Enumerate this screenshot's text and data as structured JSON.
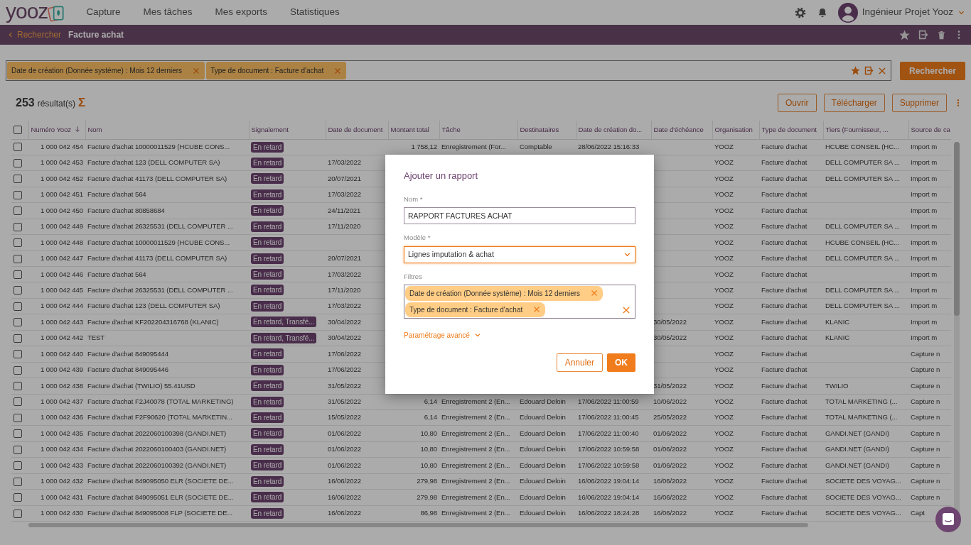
{
  "top_nav": {
    "logo": "yooz",
    "items": [
      {
        "label": "Capture",
        "selected": false
      },
      {
        "label": "Mes tâches",
        "selected": false
      },
      {
        "label": "Mes exports",
        "selected": false
      },
      {
        "label": "Statistiques",
        "selected": false
      }
    ],
    "user": "Ingénieur Projet Yooz"
  },
  "breadcrumb": {
    "back": "Rechercher",
    "title": "Facture achat"
  },
  "search": {
    "chips": [
      "Date de création (Donnée système) : Mois 12 derniers",
      "Type de document : Facture d'achat"
    ],
    "button": "Rechercher"
  },
  "results": {
    "count": "253",
    "label": "résultat(s)",
    "sum_symbol": "Σ",
    "actions": [
      "Ouvrir",
      "Télécharger",
      "Supprimer"
    ]
  },
  "table": {
    "select_all_checked": false,
    "columns": [
      {
        "label": "Numéro Yooz",
        "sorted_descending": true
      },
      {
        "label": "Nom"
      },
      {
        "label": "Signalement"
      },
      {
        "label": "Date de document"
      },
      {
        "label": "Montant total"
      },
      {
        "label": "Tâche"
      },
      {
        "label": "Destinataires"
      },
      {
        "label": "Date de création do..."
      },
      {
        "label": "Date d'échéance"
      },
      {
        "label": "Organisation"
      },
      {
        "label": "Type de document"
      },
      {
        "label": "Tiers (Fournisseur, ..."
      },
      {
        "label": "Source de ca"
      }
    ],
    "rows": [
      {
        "checked": false,
        "number": "1 000 042 454",
        "name": "Facture d'achat 10000011529 (HCUBE CONS...",
        "flag": "En retard",
        "amount": "1 758,12",
        "task": "Enregistrement (For...",
        "recipients": "Comptable",
        "created": "28/06/2022 15:16:33",
        "org": "YOOZ",
        "doc_type": "Facture d'achat",
        "third_party": "HCUBE CONSEIL (HC...",
        "source": "Import m"
      },
      {
        "checked": false,
        "number": "1 000 042 453",
        "name": "Facture d'achat 123 (DELL COMPUTER SA)",
        "flag": "En retard",
        "doc_date": "17/03/2022",
        "org": "YOOZ",
        "doc_type": "Facture d'achat",
        "third_party": "DELL COMPUTER SA ...",
        "source": "Import m"
      },
      {
        "checked": false,
        "number": "1 000 042 452",
        "name": "Facture d'achat 41173 (DELL COMPUTER SA)",
        "flag": "En retard",
        "doc_date": "20/07/2021",
        "org": "YOOZ",
        "doc_type": "Facture d'achat",
        "third_party": "DELL COMPUTER SA ...",
        "source": "Import m"
      },
      {
        "checked": false,
        "number": "1 000 042 451",
        "name": "Facture d'achat 564",
        "flag": "En retard",
        "doc_date": "17/03/2022",
        "org": "YOOZ",
        "doc_type": "Facture d'achat",
        "source": "Import m"
      },
      {
        "checked": false,
        "number": "1 000 042 450",
        "name": "Facture d'achat 80858684",
        "flag": "En retard",
        "doc_date": "24/11/2021",
        "org": "YOOZ",
        "doc_type": "Facture d'achat",
        "source": "Import m"
      },
      {
        "checked": false,
        "number": "1 000 042 449",
        "name": "Facture d'achat 26325531 (DELL COMPUTER ...",
        "flag": "En retard",
        "doc_date": "17/11/2020",
        "org": "YOOZ",
        "doc_type": "Facture d'achat",
        "third_party": "DELL COMPUTER SA ...",
        "source": "Import m"
      },
      {
        "checked": false,
        "number": "1 000 042 448",
        "name": "Facture d'achat 10000011529 (HCUBE CONS...",
        "flag": "En retard",
        "org": "YOOZ",
        "doc_type": "Facture d'achat",
        "third_party": "HCUBE CONSEIL (HC...",
        "source": "Import m"
      },
      {
        "checked": false,
        "number": "1 000 042 447",
        "name": "Facture d'achat 41173 (DELL COMPUTER SA)",
        "flag": "En retard",
        "doc_date": "20/07/2021",
        "org": "YOOZ",
        "doc_type": "Facture d'achat",
        "third_party": "DELL COMPUTER SA ...",
        "source": "Import m"
      },
      {
        "checked": false,
        "number": "1 000 042 446",
        "name": "Facture d'achat 564",
        "flag": "En retard",
        "doc_date": "17/03/2022",
        "org": "YOOZ",
        "doc_type": "Facture d'achat",
        "source": "Import m"
      },
      {
        "checked": false,
        "number": "1 000 042 445",
        "name": "Facture d'achat 26325531 (DELL COMPUTER ...",
        "flag": "En retard",
        "doc_date": "17/11/2020",
        "org": "YOOZ",
        "doc_type": "Facture d'achat",
        "third_party": "DELL COMPUTER SA ...",
        "source": "Import m"
      },
      {
        "checked": false,
        "number": "1 000 042 444",
        "name": "Facture d'achat 123 (DELL COMPUTER SA)",
        "flag": "En retard",
        "doc_date": "17/03/2022",
        "org": "YOOZ",
        "doc_type": "Facture d'achat",
        "third_party": "DELL COMPUTER SA ...",
        "source": "Import m"
      },
      {
        "checked": false,
        "number": "1 000 042 443",
        "name": "Facture d'achat KF202204316768 (KLANIC)",
        "flag": "En retard, Transfé...",
        "doc_date": "30/04/2022",
        "due": "30/05/2022",
        "org": "YOOZ",
        "doc_type": "Facture d'achat",
        "third_party": "KLANIC",
        "source": "Import m"
      },
      {
        "checked": false,
        "number": "1 000 042 442",
        "name": "TEST",
        "flag": "En retard, Transfé...",
        "doc_date": "30/04/2022",
        "due": "30/05/2022",
        "org": "YOOZ",
        "doc_type": "Facture d'achat",
        "third_party": "KLANIC",
        "source": "Import m"
      },
      {
        "checked": false,
        "number": "1 000 042 440",
        "name": "Facture d'achat 849095444",
        "flag": "En retard",
        "doc_date": "17/06/2022",
        "org": "YOOZ",
        "doc_type": "Facture d'achat",
        "source": "Capture n"
      },
      {
        "checked": false,
        "number": "1 000 042 439",
        "name": "Facture d'achat 849095446",
        "flag": "En retard",
        "doc_date": "17/06/2022",
        "org": "YOOZ",
        "doc_type": "Facture d'achat",
        "source": "Capture n"
      },
      {
        "checked": false,
        "number": "1 000 042 438",
        "name": "Facture d'achat (TWILIO) 55.41USD",
        "flag": "En retard",
        "doc_date": "31/05/2022",
        "due": "31/05/2022",
        "org": "YOOZ",
        "doc_type": "Facture d'achat",
        "third_party": "TWILIO",
        "source": "Capture n"
      },
      {
        "checked": false,
        "number": "1 000 042 437",
        "name": "Facture d'achat F2J40078 (TOTAL MARKETING)",
        "flag": "En retard",
        "doc_date": "31/05/2022",
        "amount": "6,14",
        "task": "Enregistrement 2 (En...",
        "recipients": "Edouard Deloin",
        "created": "17/06/2022 11:00:59",
        "due": "10/06/2022",
        "org": "YOOZ",
        "doc_type": "Facture d'achat",
        "third_party": "TOTAL MARKETING (...",
        "source": "Capture n"
      },
      {
        "checked": false,
        "number": "1 000 042 436",
        "name": "Facture d'achat F2F90620 (TOTAL MARKETIN...",
        "flag": "En retard",
        "doc_date": "15/05/2022",
        "amount": "6,14",
        "task": "Enregistrement 2 (En...",
        "recipients": "Edouard Deloin",
        "created": "17/06/2022 11:00:45",
        "due": "25/05/2022",
        "org": "YOOZ",
        "doc_type": "Facture d'achat",
        "third_party": "TOTAL MARKETING (...",
        "source": "Capture n"
      },
      {
        "checked": false,
        "number": "1 000 042 435",
        "name": "Facture d'achat 2022060100398 (GANDI.NET)",
        "flag": "En retard",
        "doc_date": "01/06/2022",
        "amount": "10,80",
        "task": "Enregistrement 2 (En...",
        "recipients": "Edouard Deloin",
        "created": "17/06/2022 11:00:40",
        "due": "01/06/2022",
        "org": "YOOZ",
        "doc_type": "Facture d'achat",
        "third_party": "GANDI.NET (GANDI)",
        "source": "Capture n"
      },
      {
        "checked": false,
        "number": "1 000 042 434",
        "name": "Facture d'achat 2022060100403 (GANDI.NET)",
        "flag": "En retard",
        "doc_date": "01/06/2022",
        "amount": "10,80",
        "task": "Enregistrement 2 (En...",
        "recipients": "Edouard Deloin",
        "created": "17/06/2022 10:59:58",
        "due": "01/06/2022",
        "org": "YOOZ",
        "doc_type": "Facture d'achat",
        "third_party": "GANDI.NET (GANDI)",
        "source": "Capture n"
      },
      {
        "checked": false,
        "number": "1 000 042 433",
        "name": "Facture d'achat 2022060100392 (GANDI.NET)",
        "flag": "En retard",
        "doc_date": "01/06/2022",
        "amount": "10,80",
        "task": "Enregistrement 2 (En...",
        "recipients": "Edouard Deloin",
        "created": "17/06/2022 10:59:58",
        "due": "01/06/2022",
        "org": "YOOZ",
        "doc_type": "Facture d'achat",
        "third_party": "GANDI.NET (GANDI)",
        "source": "Capture n"
      },
      {
        "checked": false,
        "number": "1 000 042 432",
        "name": "Facture d'achat 849095050 ELR (SOCIETE DE...",
        "flag": "En retard",
        "doc_date": "16/06/2022",
        "amount": "279,98",
        "task": "Enregistrement 2 (En...",
        "recipients": "Edouard Deloin",
        "created": "16/06/2022 19:04:14",
        "due": "16/06/2022",
        "org": "YOOZ",
        "doc_type": "Facture d'achat",
        "third_party": "SOCIETE DES VOYAG...",
        "source": "Capture n"
      },
      {
        "checked": false,
        "number": "1 000 042 431",
        "name": "Facture d'achat 849095051 ELR (SOCIETE DE...",
        "flag": "En retard",
        "doc_date": "16/06/2022",
        "amount": "279,98",
        "task": "Enregistrement 2 (En...",
        "recipients": "Edouard Deloin",
        "created": "16/06/2022 19:04:14",
        "due": "16/06/2022",
        "org": "YOOZ",
        "doc_type": "Facture d'achat",
        "third_party": "SOCIETE DES VOYAG...",
        "source": "Capture n"
      },
      {
        "checked": false,
        "number": "1 000 042 430",
        "name": "Facture d'achat 849095008 FLP (SOCIETE DE...",
        "flag": "En retard",
        "doc_date": "16/06/2022",
        "amount": "86,98",
        "task": "Enregistrement 2 (En...",
        "recipients": "Edouard Deloin",
        "created": "16/06/2022 18:24:28",
        "due": "16/06/2022",
        "org": "YOOZ",
        "doc_type": "Facture d'achat",
        "third_party": "SOCIETE DES VOYAG...",
        "source": "Capt"
      }
    ]
  },
  "dialog": {
    "title": "Ajouter un rapport",
    "fields": [
      {
        "kind": "text",
        "label": "Nom *",
        "value": "RAPPORT FACTURES ACHAT",
        "focused": false
      },
      {
        "kind": "select",
        "label": "Modèle *",
        "value": "Lignes imputation & achat",
        "focused": true
      },
      {
        "kind": "chips",
        "label": "Filtres",
        "chips": [
          "Date de création (Donnée système) : Mois 12 derniers",
          "Type de document : Facture d'achat"
        ]
      }
    ],
    "advanced_link": "Paramétrage avancé",
    "buttons": [
      {
        "label": "Annuler",
        "kind": "secondary"
      },
      {
        "label": "OK",
        "kind": "primary"
      }
    ]
  }
}
